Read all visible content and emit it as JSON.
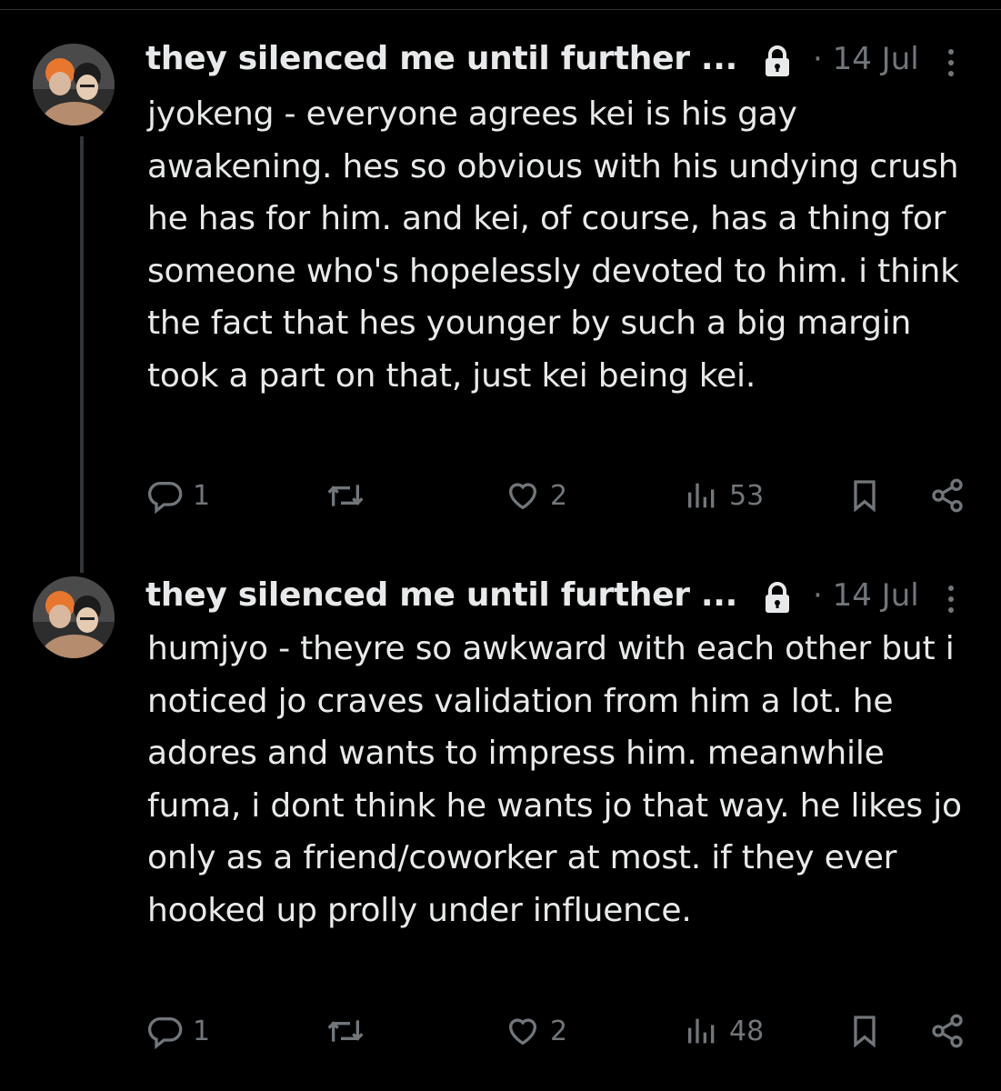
{
  "tweets": [
    {
      "display_name": "they silenced me until further ...",
      "date": "· 14 Jul",
      "text": "jyokeng - everyone agrees kei is his gay awakening. hes so obvious with his undying crush he has for him. and kei, of course, has a thing for someone who's hopelessly devoted to him. i think the fact that hes younger by such a big margin took a part on that, just kei being kei.",
      "replies": "1",
      "likes": "2",
      "views": "53"
    },
    {
      "display_name": "they silenced me until further ...",
      "date": "· 14 Jul",
      "text": "humjyo - theyre so awkward with each other but i noticed jo craves validation from him a lot. he adores and wants to impress him. meanwhile fuma, i dont think he wants jo that way. he likes jo only as a friend/coworker at most. if  they ever hooked up prolly under influence.",
      "replies": "1",
      "likes": "2",
      "views": "48"
    }
  ],
  "colors": {
    "background": "#000000",
    "text": "#e7e9ea",
    "muted": "#71767b",
    "thread_line": "#333639"
  },
  "icons": [
    "avatar",
    "lock-icon",
    "more-icon",
    "reply-icon",
    "retweet-icon",
    "like-icon",
    "views-icon",
    "bookmark-icon",
    "share-icon"
  ]
}
